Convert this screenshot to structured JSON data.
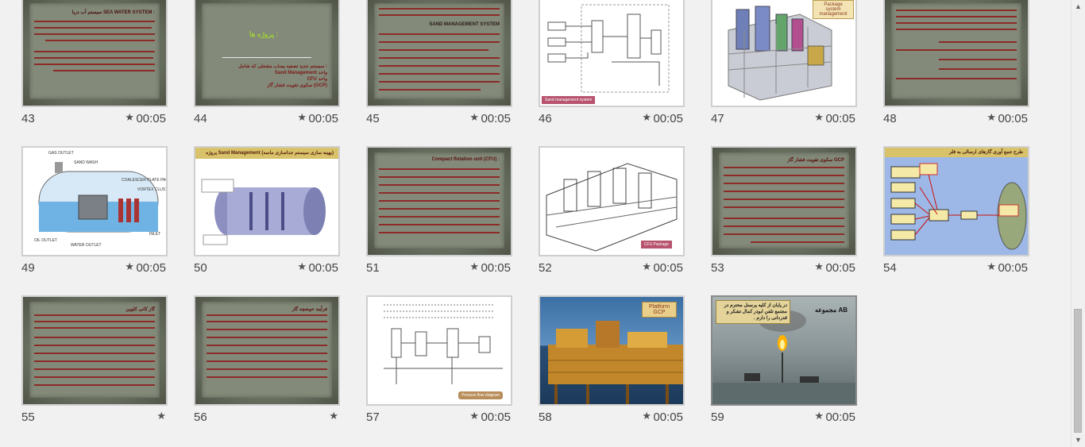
{
  "slides": [
    {
      "number": "43",
      "duration": "00:05",
      "title": "سیستم آب دریا SEA WATER SYSTEM :"
    },
    {
      "number": "44",
      "duration": "00:05",
      "title": "پروژه ها :",
      "items": [
        "سیستم جدید تصفیه پساب مشعلی که شامل :",
        "Sand Management  واحد",
        "CFU واحد",
        "سکوی تقویت فشار گاز (GCP)"
      ]
    },
    {
      "number": "45",
      "duration": "00:05",
      "title": "SAND MANAGEMENT SYSTEM"
    },
    {
      "number": "46",
      "duration": "00:05",
      "tag": "Sand management system"
    },
    {
      "number": "47",
      "duration": "00:05",
      "tag": "Package system management"
    },
    {
      "number": "48",
      "duration": "00:05"
    },
    {
      "number": "49",
      "duration": "00:05",
      "labels": [
        "GAS OUTLET",
        "SAND WASH",
        "COALESCER PLATE PACK",
        "VORTEX CLUSTER",
        "OIL OUTLET",
        "WATER OUTLET",
        "INLET"
      ]
    },
    {
      "number": "50",
      "duration": "00:05",
      "title": "پروژه Sand Management (بهینه سازی سیستم جداسازی ماسه)"
    },
    {
      "number": "51",
      "duration": "00:05",
      "title": "Compact flotation unit (CFU) :"
    },
    {
      "number": "52",
      "duration": "00:05",
      "tag": "CFU Package"
    },
    {
      "number": "53",
      "duration": "00:05",
      "title": "سکوی تقویت فشار گاز GCP"
    },
    {
      "number": "54",
      "duration": "00:05",
      "title": "طرح جمع آوری گازهای ارسالی به فلر"
    },
    {
      "number": "55",
      "duration": "",
      "title": "گاز کانی کلوین"
    },
    {
      "number": "56",
      "duration": "",
      "title": "فرآیند حوضچه گاز"
    },
    {
      "number": "57",
      "duration": "00:05",
      "tag": "Process flow diagram"
    },
    {
      "number": "58",
      "duration": "00:05",
      "tag": "Platform GCP"
    },
    {
      "number": "59",
      "duration": "00:05",
      "caption": "در پایان از کلیه پرسنل محترم در مجتمع تلفن ابوذر کمال تشکر و قدردانی را دارم .",
      "brand": "مجموعه AB"
    }
  ],
  "colors": {
    "red_text": "#8e1a1a",
    "paper": "#7e8574",
    "yellow_bar": "#d8c36a",
    "flow_bg": "#9db8e6"
  },
  "icons": {
    "star": "star-icon",
    "up": "scroll-up-arrow-icon",
    "down": "scroll-down-arrow-icon"
  }
}
